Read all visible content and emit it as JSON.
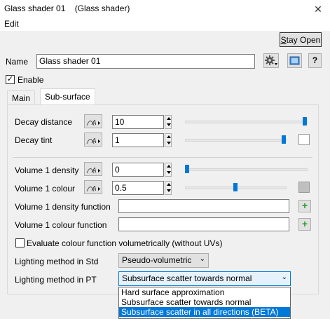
{
  "window": {
    "title": "Glass shader 01    (Glass shader)",
    "close_glyph": "✕"
  },
  "menu": {
    "edit": "Edit"
  },
  "stay_open": {
    "prefix": "S",
    "rest": "tay Open"
  },
  "name": {
    "label": "Name",
    "value": "Glass shader 01"
  },
  "enable": {
    "label": "Enable",
    "checked": true,
    "check_glyph": "✓"
  },
  "tabs": {
    "main": "Main",
    "subsurface": "Sub-surface"
  },
  "rows": {
    "decay_distance": {
      "label": "Decay distance",
      "value": "10",
      "slider": 1.0
    },
    "decay_tint": {
      "label": "Decay tint",
      "value": "1",
      "slider": 1.0,
      "swatch_color": "#ffffff"
    },
    "volume1_density": {
      "label": "Volume 1 density",
      "value": "0",
      "slider": 0.0
    },
    "volume1_colour": {
      "label": "Volume 1 colour",
      "value": "0.5",
      "slider": 0.5,
      "swatch_color": "#bfbfbf"
    },
    "volume1_density_function": {
      "label": "Volume 1 density function",
      "value": ""
    },
    "volume1_colour_function": {
      "label": "Volume 1 colour function",
      "value": ""
    }
  },
  "fn_icon_text": "A",
  "plus_glyph": "+",
  "evaluate": {
    "label": "Evaluate colour function volumetrically (without UVs)",
    "checked": false
  },
  "lighting_std": {
    "label": "Lighting method in Std",
    "value": "Pseudo-volumetric"
  },
  "lighting_pt": {
    "label": "Lighting method in PT",
    "value": "Subsurface scatter towards normal"
  },
  "dropdown_options": [
    "Hard surface approximation",
    "Subsurface scatter towards normal",
    "Subsurface scatter in all directions (BETA)"
  ],
  "chevron": "⌄",
  "colors": {
    "accent": "#0078d7",
    "window_bg": "#f0f0f0"
  }
}
